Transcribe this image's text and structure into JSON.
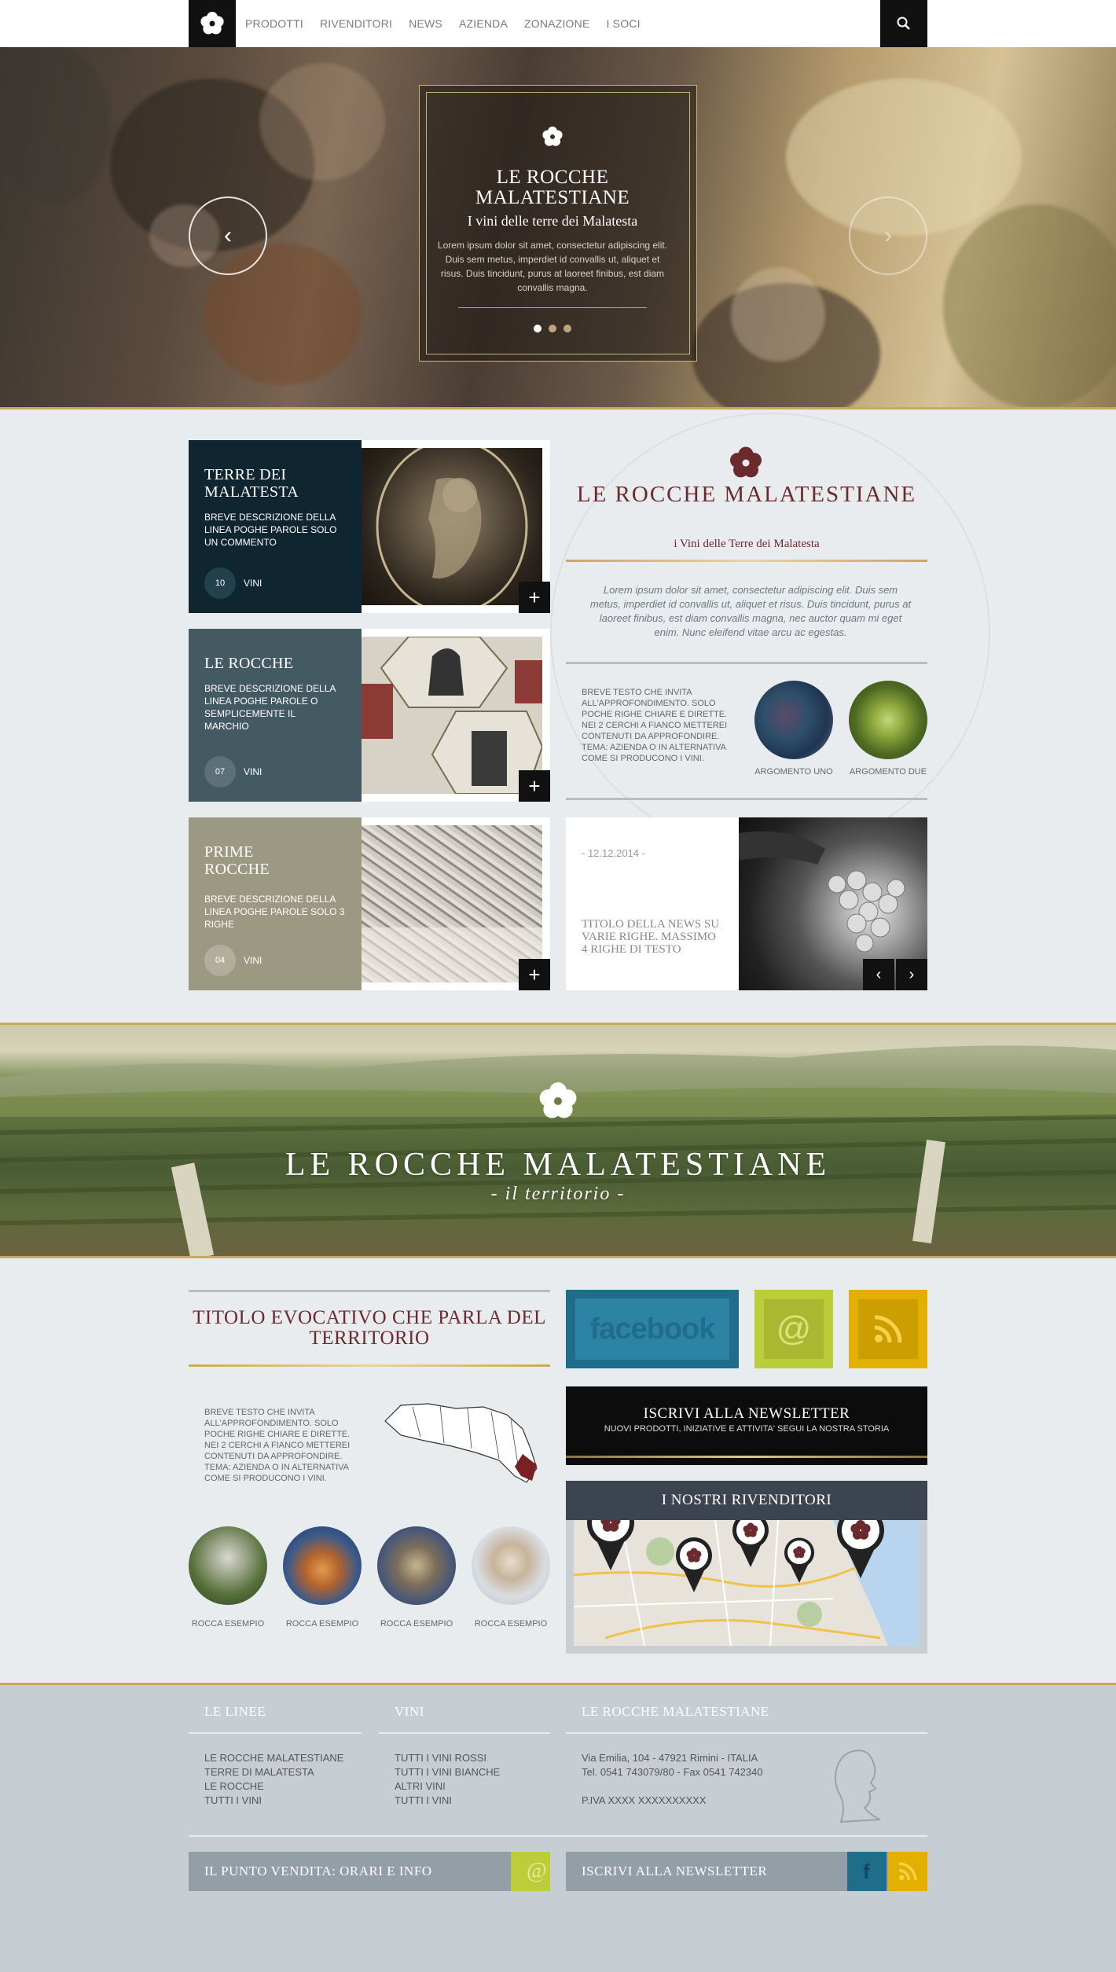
{
  "nav": {
    "items": [
      "PRODOTTI",
      "RIVENDITORI",
      "NEWS",
      "AZIENDA",
      "ZONAZIONE",
      "I SOCI"
    ],
    "logo_icon": "flower-logo-icon",
    "search_icon": "search-icon"
  },
  "hero": {
    "title": "LE ROCCHE MALATESTIANE",
    "subtitle": "I vini delle terre dei Malatesta",
    "text": "Lorem ipsum dolor sit amet, consectetur adipiscing elit. Duis sem metus, imperdiet id convallis ut, aliquet et risus. Duis tincidunt, purus at laoreet finibus, est diam convallis magna.",
    "prev_icon": "chevron-left-icon",
    "next_icon": "chevron-right-icon",
    "active_slide": 1,
    "slide_count": 3
  },
  "products": [
    {
      "name": "TERRE DEI MALATESTA",
      "desc": "BREVE DESCRIZIONE DELLA LINEA POGHE PAROLE SOLO UN COMMENTO",
      "count": "10",
      "label": "VINI",
      "color": "#0f2530"
    },
    {
      "name": "LE ROCCHE",
      "desc": "BREVE DESCRIZIONE DELLA LINEA POGHE PAROLE O SEMPLICEMENTE IL MARCHIO",
      "count": "07",
      "label": "VINI",
      "color": "#445a63"
    },
    {
      "name": "PRIME ROCCHE",
      "desc": "BREVE DESCRIZIONE DELLA LINEA POGHE PAROLE SOLO 3 RIGHE",
      "count": "04",
      "label": "VINI",
      "color": "#9b9982"
    }
  ],
  "brand": {
    "title": "LE ROCCHE MALATESTIANE",
    "subtitle": "i Vini delle Terre dei Malatesta",
    "text": "Lorem ipsum dolor sit amet, consectetur adipiscing elit. Duis sem metus, imperdiet id convallis ut, aliquet et risus. Duis tincidunt, purus at laoreet finibus, est diam convallis magna, nec auctor quam mi eget enim. Nunc eleifend vitae arcu ac egestas."
  },
  "argomenti": {
    "text": "BREVE TESTO CHE INVITA ALL'APPROFONDIMENTO. SOLO POCHE RIGHE CHIARE E DIRETTE. NEI 2 CERCHI A FIANCO METTEREI CONTENUTI DA APPROFONDIRE. TEMA: AZIENDA O IN ALTERNATIVA COME SI PRODUCONO I VINI.",
    "items": [
      "ARGOMENTO UNO",
      "ARGOMENTO DUE"
    ]
  },
  "news": {
    "date": "- 12.12.2014 -",
    "title": "TITOLO DELLA NEWS SU VARIE RIGHE. MASSIMO 4 RIGHE DI TESTO"
  },
  "territorio": {
    "title": "LE ROCCHE MALATESTIANE",
    "subtitle": "- il territorio -"
  },
  "evocativo": {
    "title": "TITOLO EVOCATIVO CHE PARLA DEL TERRITORIO",
    "text": "BREVE TESTO CHE INVITA ALL'APPROFONDIMENTO. SOLO POCHE RIGHE CHIARE E DIRETTE. NEI 2 CERCHI A FIANCO METTEREI CONTENUTI DA APPROFONDIRE. TEMA: AZIENDA O IN ALTERNATIVA COME SI PRODUCONO I VINI.",
    "rocche": [
      "ROCCA ESEMPIO",
      "ROCCA ESEMPIO",
      "ROCCA ESEMPIO",
      "ROCCA ESEMPIO"
    ]
  },
  "social": {
    "facebook": "facebook",
    "email_icon": "at-icon",
    "rss_icon": "rss-icon",
    "colors": {
      "facebook": "#1f6d8a",
      "email": "#bccd3a",
      "rss": "#e4b000"
    }
  },
  "newsletter": {
    "title": "ISCRIVI ALLA NEWSLETTER",
    "sub": "NUOVI PRODOTTI, INIZIATIVE E ATTIVITA' SEGUI LA NOSTRA STORIA"
  },
  "rivenditori": {
    "title": "I NOSTRI RIVENDITORI"
  },
  "footer": {
    "col1": {
      "title": "LE LINEE",
      "items": [
        "LE ROCCHE MALATESTIANE",
        "TERRE DI MALATESTA",
        "LE ROCCHE",
        "TUTTI I VINI"
      ]
    },
    "col2": {
      "title": "VINI",
      "items": [
        "TUTTI I VINI ROSSI",
        "TUTTI I VINI BIANCHE",
        "ALTRI VINI",
        "TUTTI I VINI"
      ]
    },
    "col3": {
      "title": "LE ROCCHE MALATESTIANE",
      "address": "Via Emilia, 104 - 47921 Rimini - ITALIA",
      "phone": "Tel. 0541 743079/80 - Fax 0541 742340",
      "piva": "P.IVA XXXX XXXXXXXXXX"
    },
    "punto_vendita": "IL PUNTO VENDITA: ORARI E INFO",
    "newsletter": "ISCRIVI ALLA NEWSLETTER"
  },
  "colors": {
    "accent_gold": "#c9a95c",
    "brand_red": "#6b2a2e",
    "dark": "#111111"
  }
}
